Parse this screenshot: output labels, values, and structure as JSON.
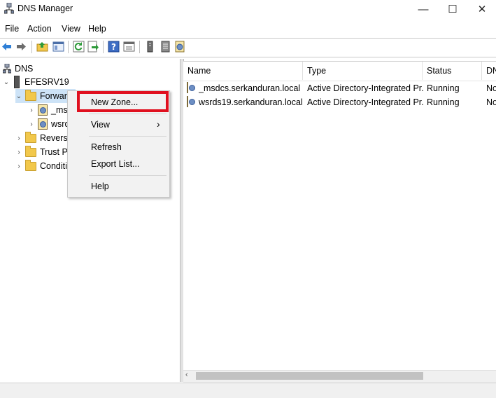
{
  "window": {
    "title": "DNS Manager",
    "minimize": "—",
    "maximize": "☐",
    "close": "✕"
  },
  "menu": [
    "File",
    "Action",
    "View",
    "Help"
  ],
  "tree": {
    "root": "DNS",
    "server": "EFESRV19",
    "forward": "Forwar",
    "zone1": "_ms",
    "zone2": "wsrd",
    "reverse": "Reverse",
    "trust": "Trust Po",
    "conditional": "Conditi"
  },
  "list": {
    "columns": [
      "Name",
      "Type",
      "Status",
      "DN"
    ],
    "rows": [
      {
        "name": "_msdcs.serkanduran.local",
        "type": "Active Directory-Integrated Pr...",
        "status": "Running",
        "dns": "No"
      },
      {
        "name": "wsrds19.serkanduran.local",
        "type": "Active Directory-Integrated Pr...",
        "status": "Running",
        "dns": "No"
      }
    ]
  },
  "context_menu": {
    "new_zone": "New Zone...",
    "view": "View",
    "view_arrow": "›",
    "refresh": "Refresh",
    "export": "Export List...",
    "help": "Help"
  },
  "colors": {
    "highlight_border": "#e0101f",
    "folder": "#f2c84b"
  },
  "icons": {
    "back": "back-arrow-icon",
    "forward": "forward-arrow-icon",
    "up": "up-folder-icon",
    "console": "console-tree-icon",
    "refresh": "refresh-icon",
    "export": "export-icon",
    "help": "help-icon",
    "properties": "properties-icon"
  }
}
